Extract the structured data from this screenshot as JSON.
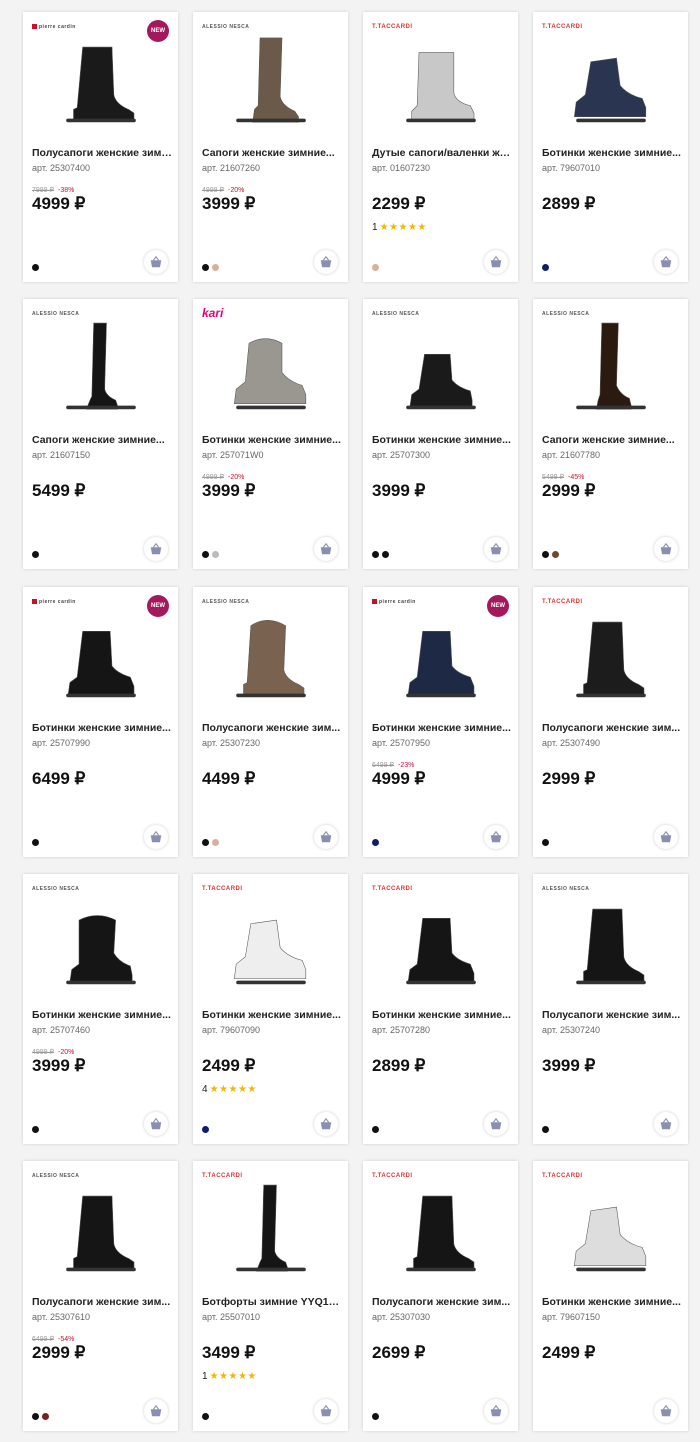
{
  "products": [
    {
      "brand": "pierre cardin",
      "brand_style": "pierre",
      "badge": "NEW",
      "title": "Полусапоги женские зимние...",
      "art": "арт. 25307400",
      "old_price": "7999 ₽",
      "discount": "-38%",
      "price": "4999 ₽",
      "rating": "",
      "stars": "",
      "swatches": [
        "#111111"
      ],
      "shape": "boot-mid",
      "color": "#1a1a1a"
    },
    {
      "brand": "ALESSIO NESCA",
      "brand_style": "plain",
      "badge": "",
      "title": "Сапоги женские зимние...",
      "art": "арт. 21607260",
      "old_price": "4999 ₽",
      "discount": "-20%",
      "price": "3999 ₽",
      "rating": "",
      "stars": "",
      "swatches": [
        "#111111",
        "#d9b0a0"
      ],
      "shape": "boot-tall",
      "color": "#6b5a4a"
    },
    {
      "brand": "T.TACCARDI",
      "brand_style": "taccardi",
      "badge": "",
      "title": "Дутые сапоги/валенки же...",
      "art": "арт. 01607230",
      "old_price": "",
      "discount": "",
      "price": "2299 ₽",
      "rating": "1",
      "stars": "★★★★★",
      "swatches": [
        "#d9b0a0"
      ],
      "shape": "ugg",
      "color": "#c8c8c8"
    },
    {
      "brand": "T.TACCARDI",
      "brand_style": "taccardi",
      "badge": "",
      "title": "Ботинки женские зимние...",
      "art": "арт. 79607010",
      "old_price": "",
      "discount": "",
      "price": "2899 ₽",
      "rating": "",
      "stars": "",
      "swatches": [
        "#0b1f6b"
      ],
      "shape": "sneaker-high",
      "color": "#2a3552"
    },
    {
      "brand": "ALESSIO NESCA",
      "brand_style": "plain",
      "badge": "",
      "title": "Сапоги женские зимние...",
      "art": "арт. 21607150",
      "old_price": "",
      "discount": "",
      "price": "5499 ₽",
      "rating": "",
      "stars": "",
      "swatches": [
        "#111111"
      ],
      "shape": "boot-tall-thin",
      "color": "#151515"
    },
    {
      "brand": "kari",
      "brand_style": "kari",
      "badge": "",
      "title": "Ботинки женские зимние...",
      "art": "арт. 257071W0",
      "old_price": "4999 ₽",
      "discount": "-20%",
      "price": "3999 ₽",
      "rating": "",
      "stars": "",
      "swatches": [
        "#111111",
        "#bbbbbb"
      ],
      "shape": "sneaker-fur",
      "color": "#9a9690"
    },
    {
      "brand": "ALESSIO NESCA",
      "brand_style": "plain",
      "badge": "",
      "title": "Ботинки женские зимние...",
      "art": "арт. 25707300",
      "old_price": "",
      "discount": "",
      "price": "3999 ₽",
      "rating": "",
      "stars": "",
      "swatches": [
        "#111111",
        "#111111"
      ],
      "shape": "ankle",
      "color": "#1a1a1a"
    },
    {
      "brand": "ALESSIO NESCA",
      "brand_style": "plain",
      "badge": "",
      "title": "Сапоги женские зимние...",
      "art": "арт. 21607780",
      "old_price": "5499 ₽",
      "discount": "-45%",
      "price": "2999 ₽",
      "rating": "",
      "stars": "",
      "swatches": [
        "#111111",
        "#6b4a30"
      ],
      "shape": "boot-tall-wedge",
      "color": "#2a1a10"
    },
    {
      "brand": "pierre cardin",
      "brand_style": "pierre",
      "badge": "NEW",
      "title": "Ботинки женские зимние...",
      "art": "арт. 25707990",
      "old_price": "",
      "discount": "",
      "price": "6499 ₽",
      "rating": "",
      "stars": "",
      "swatches": [
        "#111111"
      ],
      "shape": "combat",
      "color": "#151515"
    },
    {
      "brand": "ALESSIO NESCA",
      "brand_style": "plain",
      "badge": "",
      "title": "Полусапоги женские зим...",
      "art": "арт. 25307230",
      "old_price": "",
      "discount": "",
      "price": "4499 ₽",
      "rating": "",
      "stars": "",
      "swatches": [
        "#111111",
        "#d9b0a0"
      ],
      "shape": "boot-mid-fur",
      "color": "#7a6250"
    },
    {
      "brand": "pierre cardin",
      "brand_style": "pierre",
      "badge": "NEW",
      "title": "Ботинки женские зимние...",
      "art": "арт. 25707950",
      "old_price": "6499 ₽",
      "discount": "-23%",
      "price": "4999 ₽",
      "rating": "",
      "stars": "",
      "swatches": [
        "#0b1f6b"
      ],
      "shape": "combat",
      "color": "#1e2a45"
    },
    {
      "brand": "T.TACCARDI",
      "brand_style": "taccardi",
      "badge": "",
      "title": "Полусапоги женские зим...",
      "art": "арт. 25307490",
      "old_price": "",
      "discount": "",
      "price": "2999 ₽",
      "rating": "",
      "stars": "",
      "swatches": [
        "#111111"
      ],
      "shape": "boot-mid",
      "color": "#1c1c1c"
    },
    {
      "brand": "ALESSIO NESCA",
      "brand_style": "plain",
      "badge": "",
      "title": "Ботинки женские зимние...",
      "art": "арт. 25707460",
      "old_price": "4999 ₽",
      "discount": "-20%",
      "price": "3999 ₽",
      "rating": "",
      "stars": "",
      "swatches": [
        "#111111"
      ],
      "shape": "ankle-fur",
      "color": "#151515"
    },
    {
      "brand": "T.TACCARDI",
      "brand_style": "taccardi",
      "badge": "",
      "title": "Ботинки женские зимние...",
      "art": "арт. 79607090",
      "old_price": "",
      "discount": "",
      "price": "2499 ₽",
      "rating": "4",
      "stars": "★★★★★",
      "swatches": [
        "#0b1f6b"
      ],
      "shape": "sneaker-high",
      "color": "#eeeeee"
    },
    {
      "brand": "T.TACCARDI",
      "brand_style": "taccardi",
      "badge": "",
      "title": "Ботинки женские зимние...",
      "art": "арт. 25707280",
      "old_price": "",
      "discount": "",
      "price": "2899 ₽",
      "rating": "",
      "stars": "",
      "swatches": [
        "#111111"
      ],
      "shape": "combat",
      "color": "#151515"
    },
    {
      "brand": "ALESSIO NESCA",
      "brand_style": "plain",
      "badge": "",
      "title": "Полусапоги женские зим...",
      "art": "арт. 25307240",
      "old_price": "",
      "discount": "",
      "price": "3999 ₽",
      "rating": "",
      "stars": "",
      "swatches": [
        "#111111"
      ],
      "shape": "boot-mid",
      "color": "#151515"
    },
    {
      "brand": "ALESSIO NESCA",
      "brand_style": "plain",
      "badge": "",
      "title": "Полусапоги женские зим...",
      "art": "арт. 25307610",
      "old_price": "6499 ₽",
      "discount": "-54%",
      "price": "2999 ₽",
      "rating": "",
      "stars": "",
      "swatches": [
        "#111111",
        "#7a1f1f"
      ],
      "shape": "boot-mid",
      "color": "#151515"
    },
    {
      "brand": "T.TACCARDI",
      "brand_style": "taccardi",
      "badge": "",
      "title": "Ботфорты зимние YYQ19...",
      "art": "арт. 25507010",
      "old_price": "",
      "discount": "",
      "price": "3499 ₽",
      "rating": "1",
      "stars": "★★★★★",
      "swatches": [
        "#111111"
      ],
      "shape": "boot-tall-thin",
      "color": "#151515"
    },
    {
      "brand": "T.TACCARDI",
      "brand_style": "taccardi",
      "badge": "",
      "title": "Полусапоги женские зим...",
      "art": "арт. 25307030",
      "old_price": "",
      "discount": "",
      "price": "2699 ₽",
      "rating": "",
      "stars": "",
      "swatches": [
        "#111111"
      ],
      "shape": "boot-mid",
      "color": "#151515"
    },
    {
      "brand": "T.TACCARDI",
      "brand_style": "taccardi",
      "badge": "",
      "title": "Ботинки женские зимние...",
      "art": "арт. 79607150",
      "old_price": "",
      "discount": "",
      "price": "2499 ₽",
      "rating": "",
      "stars": "",
      "swatches": [],
      "shape": "sneaker-high",
      "color": "#dddddd"
    }
  ]
}
